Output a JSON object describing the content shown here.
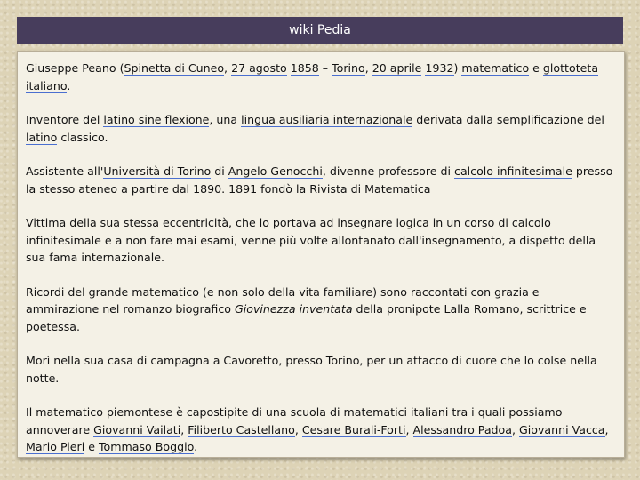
{
  "header": {
    "title": "wiki Pedia"
  },
  "paragraphs": [
    {
      "parts": [
        {
          "t": "Giuseppe Peano ("
        },
        {
          "t": "Spinetta di Cuneo",
          "link": true
        },
        {
          "t": ", "
        },
        {
          "t": "27 agosto",
          "link": true
        },
        {
          "t": " "
        },
        {
          "t": "1858",
          "link": true
        },
        {
          "t": " – "
        },
        {
          "t": "Torino",
          "link": true
        },
        {
          "t": ", "
        },
        {
          "t": "20 aprile",
          "link": true
        },
        {
          "t": " "
        },
        {
          "t": "1932",
          "link": true
        },
        {
          "t": ") "
        },
        {
          "t": "matematico",
          "link": true
        },
        {
          "t": " e "
        },
        {
          "t": "glottoteta italiano",
          "link": true
        },
        {
          "t": "."
        }
      ]
    },
    {
      "parts": [
        {
          "t": "Inventore del "
        },
        {
          "t": "latino sine flexione",
          "link": true
        },
        {
          "t": ", una "
        },
        {
          "t": "lingua ausiliaria internazionale",
          "link": true
        },
        {
          "t": " derivata dalla semplificazione del "
        },
        {
          "t": "latino",
          "link": true
        },
        {
          "t": " classico."
        }
      ]
    },
    {
      "parts": [
        {
          "t": "Assistente all'"
        },
        {
          "t": "Università di Torino",
          "link": true
        },
        {
          "t": " di "
        },
        {
          "t": "Angelo Genocchi",
          "link": true
        },
        {
          "t": ", divenne professore di "
        },
        {
          "t": "calcolo infinitesimale",
          "link": true
        },
        {
          "t": " presso la stesso ateneo a partire dal "
        },
        {
          "t": "1890",
          "link": true
        },
        {
          "t": ". 1891 fondò la Rivista di Matematica"
        }
      ]
    },
    {
      "parts": [
        {
          "t": "Vittima della sua stessa eccentricità, che lo portava ad insegnare logica in un corso di calcolo infinitesimale e a non fare mai esami, venne più volte allontanato dall'insegnamento, a dispetto della sua fama internazionale."
        }
      ]
    },
    {
      "parts": [
        {
          "t": "Ricordi del grande matematico (e non solo della vita familiare) sono raccontati con grazia e ammirazione nel romanzo biografico "
        },
        {
          "t": "Giovinezza inventata",
          "italic": true
        },
        {
          "t": " della pronipote "
        },
        {
          "t": "Lalla Romano",
          "link": true
        },
        {
          "t": ", scrittrice e poetessa."
        }
      ]
    },
    {
      "parts": [
        {
          "t": "Morì nella sua casa di campagna a Cavoretto, presso Torino, per un attacco di cuore che lo colse nella notte."
        }
      ]
    },
    {
      "parts": [
        {
          "t": "Il matematico piemontese è capostipite di una scuola di matematici italiani tra i quali possiamo annoverare "
        },
        {
          "t": "Giovanni Vailati",
          "link": true
        },
        {
          "t": ", "
        },
        {
          "t": "Filiberto Castellano",
          "link": true
        },
        {
          "t": ", "
        },
        {
          "t": "Cesare Burali-Forti",
          "link": true
        },
        {
          "t": ", "
        },
        {
          "t": "Alessandro Padoa",
          "link": true
        },
        {
          "t": ", "
        },
        {
          "t": "Giovanni Vacca",
          "link": true
        },
        {
          "t": ", "
        },
        {
          "t": "Mario Pieri",
          "link": true
        },
        {
          "t": " e "
        },
        {
          "t": "Tommaso Boggio",
          "link": true
        },
        {
          "t": "."
        }
      ]
    }
  ]
}
